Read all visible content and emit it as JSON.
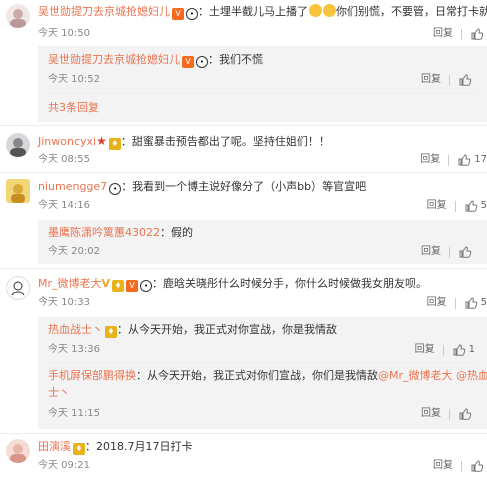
{
  "comments": [
    {
      "user": "吴世勋提刀去京城抢媳妇儿",
      "text": "：土埋半截儿马上播了",
      "text2": "你们别慌，不要管，日常打卡就行",
      "time": "今天 10:50",
      "reply": "回复",
      "like": ""
    },
    {
      "user": "Jinwoncyxi",
      "text": "：甜蜜暴击预告都出了呢。坚持住姐们！！",
      "time": "今天 08:55",
      "reply": "回复",
      "like": "17"
    },
    {
      "user": "niumengge7",
      "text": "：我看到一个博主说好像分了（小声bb）等官宣吧",
      "time": "今天 14:16",
      "reply": "回复",
      "like": "5"
    },
    {
      "user": "Mr_微博老大",
      "text": "：鹿晗关晓彤什么时候分手，你什么时候做我女朋友呗。",
      "time": "今天 10:33",
      "reply": "回复",
      "like": "5"
    },
    {
      "user": "田演溪",
      "text": "：2018.7月17日打卡",
      "time": "今天 09:21",
      "reply": "回复",
      "like": ""
    }
  ],
  "replies": [
    {
      "user": "吴世勋提刀去京城抢媳妇儿",
      "text": "：我们不慌",
      "time": "今天 10:52",
      "reply": "回复",
      "like": ""
    },
    {
      "user": "墨鹰陈潇吟篱蕙43022",
      "text": "：假的",
      "time": "今天 20:02",
      "reply": "回复",
      "like": ""
    },
    {
      "user": "热血战士丶",
      "text": "：从今天开始，我正式对你宣战，你是我情敌",
      "time": "今天 13:36",
      "reply": "回复",
      "like": "1"
    },
    {
      "user": "手机屏保部鹏得换",
      "text": "：从今天开始，我正式对你们宣战，你们是我情敌",
      "mention1": "@Mr_微博老大",
      "mention2": "@热血战",
      "line2": "士丶",
      "time": "今天 11:15",
      "reply": "回复",
      "like": ""
    }
  ],
  "more_replies": "共3条回复",
  "colors": {
    "username": "#eb7350",
    "subbox_bg": "#f3f3f3"
  }
}
